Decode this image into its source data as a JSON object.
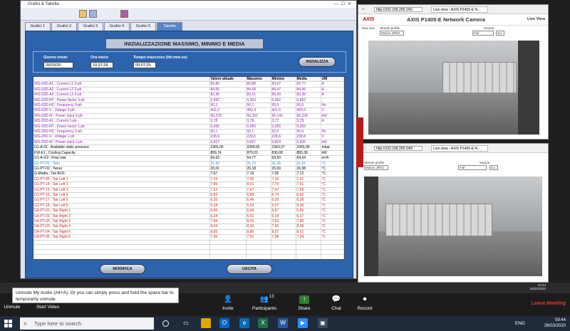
{
  "app": {
    "title": "Grafici & Tabella",
    "tabs": [
      "Grafici 1",
      "Grafici 2",
      "Grafici 3",
      "Grafici 4",
      "Grafici 5",
      "Tabella"
    ],
    "heading": "INIZIALIZZAZIONE MASSIMO, MINIMO E MEDIA",
    "labels": {
      "start_date": "Giorno inizio",
      "start_time": "Ora inizio",
      "elapsed": "Tempo trascorso (hh:mm:ss)"
    },
    "values": {
      "start_date": "26/03/20",
      "start_time": "10:37:28",
      "elapsed": "00:07:25"
    },
    "buttons": {
      "initialize": "INIZIALIZZA",
      "modify": "MODIFICA",
      "exit": "USCITA"
    },
    "table": {
      "headers": [
        "",
        "Valore attuale",
        "Massimo",
        "Minimo",
        "Media",
        "UM"
      ],
      "rows": [
        {
          "name": "WG-63D-A1 ; Current L1 3-ph",
          "v": "83,85",
          "max": "83,88",
          "min": "83,67",
          "avg": "83,77",
          "um": "A",
          "color": "purple"
        },
        {
          "name": "WG-63D-A2 ; Current L2 3-ph",
          "v": "84,65",
          "max": "84,68",
          "min": "84,47",
          "avg": "84,56",
          "um": "A",
          "color": "purple"
        },
        {
          "name": "WG-63D-A3 ; Current L3 3-ph",
          "v": "83,36",
          "max": "83,51",
          "min": "83,30",
          "avg": "83,39",
          "um": "A",
          "color": "purple"
        },
        {
          "name": "WG-63D-FP ; Power factor 3-ph",
          "v": "0,962",
          "max": "0,963",
          "min": "0,962",
          "avg": "0,962",
          "um": "",
          "color": "purple"
        },
        {
          "name": "WG-63D-HZ ; Frequency 3-ph",
          "v": "50,1",
          "max": "50,1",
          "min": "50,0",
          "avg": "50,0",
          "um": "Hz",
          "color": "purple"
        },
        {
          "name": "WG-63D-V ; Voltage 3-ph",
          "v": "402,2",
          "max": "402,4",
          "min": "401,6",
          "avg": "402,0",
          "um": "V",
          "color": "purple"
        },
        {
          "name": "WG-63D-W ; Power input 3-ph",
          "v": "56,278",
          "max": "56,331",
          "min": "56,143",
          "avg": "56,239",
          "um": "kW",
          "color": "purple"
        },
        {
          "name": "WG-25D-A1 ; Current 1-ph",
          "v": "3,78",
          "max": "3,78",
          "min": "3,77",
          "avg": "3,78",
          "um": "A",
          "color": "purple"
        },
        {
          "name": "WG-25D-FP ; Power factor 1-ph",
          "v": "0,955",
          "max": "0,955",
          "min": "0,955",
          "avg": "0,955",
          "um": "",
          "color": "purple"
        },
        {
          "name": "WG-25D-HZ ; Frequency 1-ph",
          "v": "50,1",
          "max": "50,1",
          "min": "50,0",
          "avg": "50,0",
          "um": "Hz",
          "color": "purple"
        },
        {
          "name": "WG-25D-V ; Voltage 1-ph",
          "v": "228,9",
          "max": "229,0",
          "min": "228,6",
          "avg": "228,8",
          "um": "V",
          "color": "purple"
        },
        {
          "name": "WG-25D-W ; Power input 1-ph",
          "v": "0,827",
          "max": "0,827",
          "min": "0,824",
          "avg": "0,826",
          "um": "kW",
          "color": "purple"
        },
        {
          "name": "G1-A-01 ; Available static pressure",
          "v": "2365,05",
          "max": "2368,65",
          "min": "2363,37",
          "avg": "2365,39",
          "um": "mbar",
          "color": "black"
        },
        {
          "name": "KW-E1 ; Cooling Capacity",
          "v": "859,74",
          "max": "870,03",
          "min": "836,68",
          "avg": "855,38",
          "um": "kW",
          "color": "black"
        },
        {
          "name": "G1-A-G3 ; Flow rate",
          "v": "64,63",
          "max": "64,77",
          "min": "64,50",
          "avg": "64,64",
          "um": "m³/h",
          "color": "black"
        },
        {
          "name": "G1-PT-01 ; Twin",
          "v": "31,50",
          "max": "31,73",
          "min": "31,36",
          "avg": "31,51",
          "um": "°C",
          "color": "cyan"
        },
        {
          "name": "G1-PT-02 ; Twout",
          "v": "20,01",
          "max": "20,18",
          "min": "20,00",
          "avg": "20,08",
          "um": "°C",
          "color": "black"
        },
        {
          "name": "G-Media ; Tair AVG",
          "v": "7,07",
          "max": "7,19",
          "min": "7,06",
          "avg": "7,12",
          "um": "°C",
          "color": "black"
        },
        {
          "name": "G1-PT-06 ; Tair Left 1",
          "v": "7,23",
          "max": "7,30",
          "min": "7,16",
          "avg": "7,21",
          "um": "°C",
          "color": "red"
        },
        {
          "name": "G1-PT-14 ; Tair Left 2",
          "v": "7,86",
          "max": "8,01",
          "min": "7,79",
          "avg": "7,91",
          "um": "°C",
          "color": "red"
        },
        {
          "name": "G1-PT-15 ; Tair Left 3",
          "v": "7,52",
          "max": "7,67",
          "min": "7,47",
          "avg": "7,58",
          "um": "°C",
          "color": "red"
        },
        {
          "name": "G1-PT-16 ; Tair Left 4",
          "v": "6,83",
          "max": "6,89",
          "min": "6,74",
          "avg": "6,82",
          "um": "°C",
          "color": "red"
        },
        {
          "name": "G1-PT-17 ; Tair Left 5",
          "v": "6,30",
          "max": "6,46",
          "min": "6,29",
          "avg": "6,38",
          "um": "°C",
          "color": "red"
        },
        {
          "name": "G1-PT-18 ; Tair Left 6",
          "v": "5,38",
          "max": "5,53",
          "min": "5,37",
          "avg": "5,46",
          "um": "°C",
          "color": "red"
        },
        {
          "name": "G4-PT-01 ; Tair Right 1",
          "v": "5,85",
          "max": "6,04",
          "min": "5,67",
          "avg": "5,86",
          "um": "°C",
          "color": "red"
        },
        {
          "name": "G4-PT-02 ; Tair Right 2",
          "v": "6,24",
          "max": "6,51",
          "min": "6,19",
          "avg": "6,37",
          "um": "°C",
          "color": "red"
        },
        {
          "name": "G4-PT-03 ; Tair Right 3",
          "v": "7,66",
          "max": "8,03",
          "min": "7,53",
          "avg": "7,80",
          "um": "°C",
          "color": "red"
        },
        {
          "name": "G4-PT-03 ; Tair Right 4",
          "v": "8,04",
          "max": "8,39",
          "min": "7,95",
          "avg": "8,08",
          "um": "°C",
          "color": "red"
        },
        {
          "name": "G4-PT-04 ; Tair Right 5",
          "v": "8,60",
          "max": "8,80",
          "min": "8,37",
          "avg": "8,62",
          "um": "°C",
          "color": "red"
        },
        {
          "name": "G4-PT-05 ; Tair Right 6",
          "v": "7,30",
          "max": "7,52",
          "min": "7,08",
          "avg": "7,34",
          "um": "°C",
          "color": "red"
        }
      ]
    }
  },
  "camera_top": {
    "url": "http://192.168.200.241/",
    "tab": "Live view - AXIS P1405-E N...",
    "logo": "AXIS",
    "title": "AXIS P1405-E Network Camera",
    "live": "Live View",
    "labels": {
      "view_size": "View size",
      "stream": "Stream profile",
      "source": "Source"
    },
    "stream_value": "Motion JPEG",
    "source_value": "Full",
    "go": "Go"
  },
  "camera_bottom": {
    "url": "http://192.168.200.240/",
    "tab": "Live view - AXIS P1405-E N...",
    "labels": {
      "stream": "Stream profile",
      "source": "Source"
    },
    "stream_value": "Motion JPEG",
    "source_value": "Full",
    "go": "Go"
  },
  "remote_clock": {
    "time": "10:44",
    "date": "26/03/2020"
  },
  "zoom": {
    "tooltip": "Unmute My Audio (Alt+A). Or you can simply press and hold the space bar to temporarily unmute.",
    "unmute": "Unmute",
    "start_video": "Start Video",
    "invite": "Invite",
    "participants": "Participants",
    "participants_count": "13",
    "share": "Share",
    "chat": "Chat",
    "record": "Record",
    "leave": "Leave Meeting"
  },
  "taskbar": {
    "search_placeholder": "Type here to search",
    "lang": "ENG",
    "time": "09:44",
    "date": "26/03/2020"
  }
}
